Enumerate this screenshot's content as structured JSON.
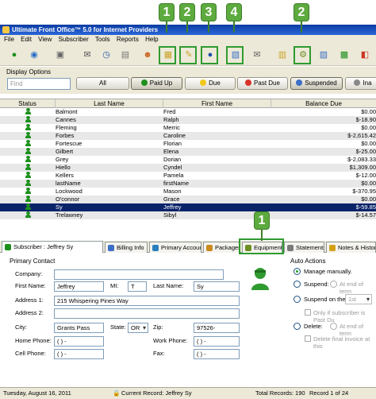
{
  "callouts": [
    "1",
    "2",
    "3",
    "4",
    "2",
    "1"
  ],
  "window": {
    "title": "Ultimate Front Office™ 5.0 for Internet Providers"
  },
  "menu": [
    "File",
    "Edit",
    "View",
    "Subscriber",
    "Tools",
    "Reports",
    "Help"
  ],
  "display_options": {
    "label": "Display Options",
    "find_placeholder": "Find",
    "filters": [
      {
        "label": "All",
        "dot": ""
      },
      {
        "label": "Paid Up",
        "dot": "#1d8f1d"
      },
      {
        "label": "Due",
        "dot": "#f2c81a"
      },
      {
        "label": "Past Due",
        "dot": "#d8342a"
      },
      {
        "label": "Suspended",
        "dot": "#3c6fc6"
      },
      {
        "label": "Ina",
        "dot": "#888888"
      }
    ]
  },
  "grid": {
    "columns": [
      "Status",
      "Last Name",
      "First Name",
      "Balance Due"
    ],
    "rows": [
      {
        "last": "Balmont",
        "first": "Fred",
        "balance": "$0.00"
      },
      {
        "last": "Cannes",
        "first": "Ralph",
        "balance": "$-18.90"
      },
      {
        "last": "Fleming",
        "first": "Merric",
        "balance": "$0.00"
      },
      {
        "last": "Forbes",
        "first": "Caroline",
        "balance": "$-2,615.42"
      },
      {
        "last": "Fortescue",
        "first": "Florian",
        "balance": "$0.00"
      },
      {
        "last": "Gilbert",
        "first": "Elena",
        "balance": "$-25.00"
      },
      {
        "last": "Grey",
        "first": "Dorian",
        "balance": "$-2,083.33"
      },
      {
        "last": "Hiello",
        "first": "Cyndel",
        "balance": "$1,309.00"
      },
      {
        "last": "Kellers",
        "first": "Pamela",
        "balance": "$-12.00"
      },
      {
        "last": "lastName",
        "first": "firstName",
        "balance": "$0.00"
      },
      {
        "last": "Lockwood",
        "first": "Mason",
        "balance": "$-370.95"
      },
      {
        "last": "O'connor",
        "first": "Grace",
        "balance": "$0.00"
      },
      {
        "last": "Sy",
        "first": "Jeffrey",
        "balance": "$-59.85"
      },
      {
        "last": "Trelawney",
        "first": "Sibyl",
        "balance": "$-14.57"
      }
    ],
    "selected_index": 12
  },
  "tabs": [
    {
      "label": "Subscriber : Jeffrey Sy",
      "color": "#1d8f1d"
    },
    {
      "label": "Billing Info",
      "color": "#3c6fc6"
    },
    {
      "label": "Primary Account",
      "color": "#2a7fbf"
    },
    {
      "label": "Packages",
      "color": "#c98a1e"
    },
    {
      "label": "Equipment",
      "color": "#6b8e23"
    },
    {
      "label": "Statements",
      "color": "#7a7a7a"
    },
    {
      "label": "Notes & Histor",
      "color": "#d4a017"
    }
  ],
  "contact": {
    "section": "Primary Contact",
    "company_label": "Company:",
    "company": "",
    "first_label": "First Name:",
    "first": "Jeffrey",
    "mi_label": "MI:",
    "mi": "T",
    "last_label": "Last Name:",
    "last": "Sy",
    "addr1_label": "Address 1:",
    "addr1": "215 Whispering Pines Way",
    "addr2_label": "Address 2:",
    "addr2": "",
    "city_label": "City:",
    "city": "Grants Pass",
    "state_label": "State:",
    "state": "OR",
    "zip_label": "Zip:",
    "zip": "97526-",
    "home_label": "Home Phone:",
    "home": "(   )   -",
    "work_label": "Work Phone:",
    "work": "(   )   -",
    "cell_label": "Cell Phone:",
    "cell": "(   )   -",
    "fax_label": "Fax:",
    "fax": "(   )   -"
  },
  "auto_actions": {
    "section": "Auto Actions",
    "manage": "Manage manually.",
    "suspend": "Suspend:",
    "suspend_hint": "At end of term",
    "suspend_on": "Suspend on the",
    "suspend_on_value": "1st",
    "only_if": "Only if subscriber is Past Du",
    "delete": "Delete:",
    "delete_hint": "At end of term",
    "delete_final": "Delete final invoice at this"
  },
  "status": {
    "date": "Tuesday, August 16, 2011",
    "current": "Current Record: Jeffrey Sy",
    "total": "Total Records: 190",
    "record": "Record 1 of 24"
  }
}
